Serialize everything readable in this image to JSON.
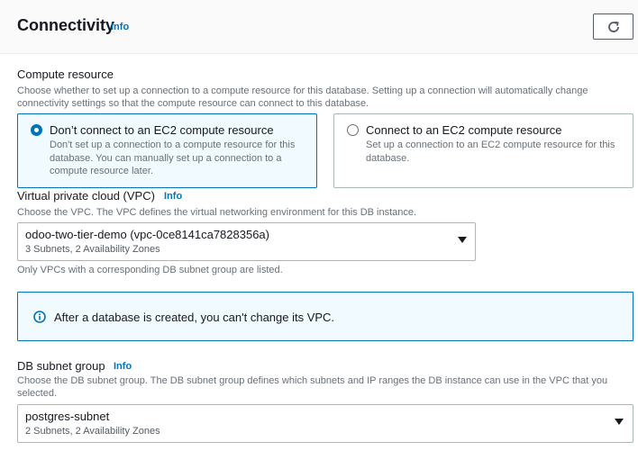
{
  "section": {
    "title": "Connectivity",
    "info": "Info"
  },
  "compute": {
    "label": "Compute resource",
    "description": "Choose whether to set up a connection to a compute resource for this database. Setting up a connection will automatically change connectivity settings so that the compute resource can connect to this database.",
    "options": [
      {
        "title": "Don’t connect to an EC2 compute resource",
        "description": "Don't set up a connection to a compute resource for this database. You can manually set up a connection to a compute resource later.",
        "selected": true
      },
      {
        "title": "Connect to an EC2 compute resource",
        "description": "Set up a connection to an EC2 compute resource for this database.",
        "selected": false
      }
    ]
  },
  "vpc": {
    "label": "Virtual private cloud (VPC)",
    "info": "Info",
    "description": "Choose the VPC. The VPC defines the virtual networking environment for this DB instance.",
    "value": "odoo-two-tier-demo (vpc-0ce8141ca7828356a)",
    "sub": "3 Subnets, 2 Availability Zones",
    "hint": "Only VPCs with a corresponding DB subnet group are listed."
  },
  "alert": {
    "text": "After a database is created, you can't change its VPC."
  },
  "subnet": {
    "label": "DB subnet group",
    "info": "Info",
    "description": "Choose the DB subnet group. The DB subnet group defines which subnets and IP ranges the DB instance can use in the VPC that you selected.",
    "value": "postgres-subnet",
    "sub": "2 Subnets, 2 Availability Zones"
  },
  "colors": {
    "accent": "#0073bb",
    "selected_bg": "#f1faff",
    "text": "#16191f",
    "muted": "#687078"
  }
}
